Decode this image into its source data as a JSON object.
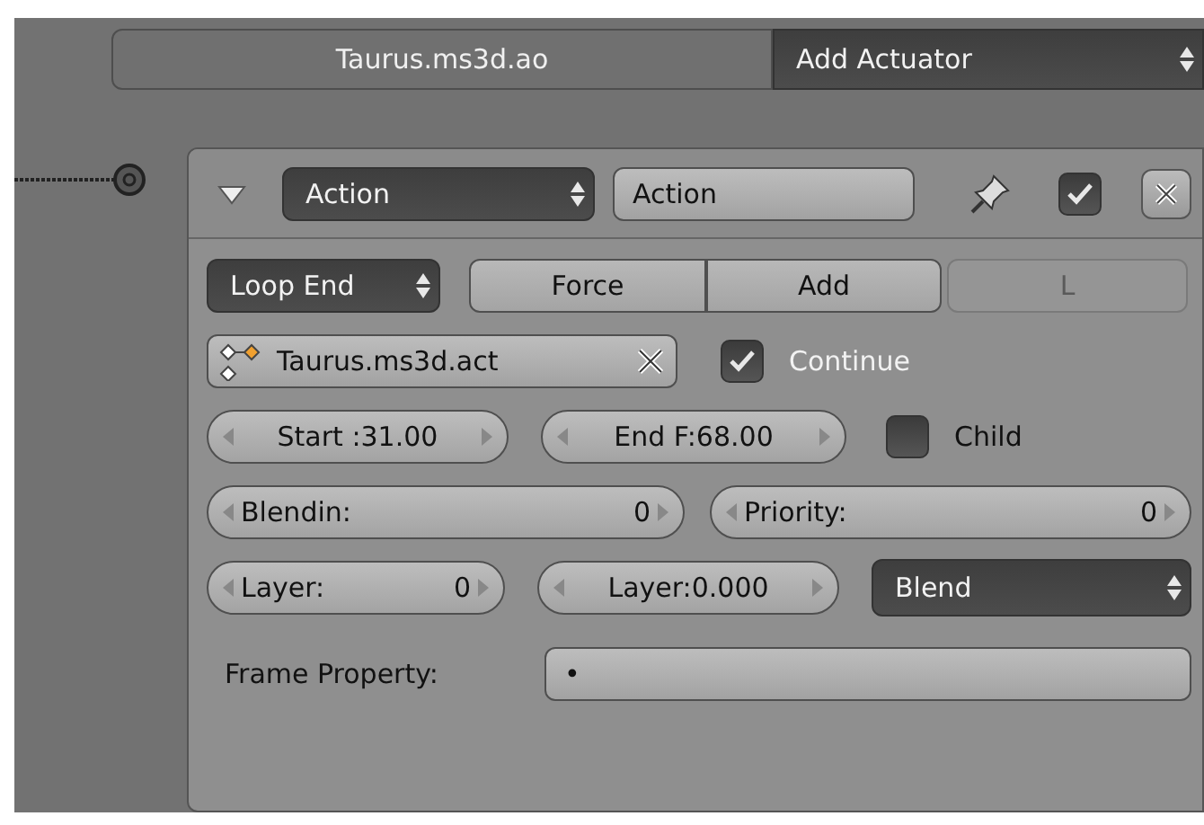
{
  "top_bar": {
    "object_name": "Taurus.ms3d.ao",
    "add_menu": "Add Actuator"
  },
  "actuator": {
    "expanded": true,
    "type": "Action",
    "name": "Action",
    "active": true,
    "play_mode": "Loop End",
    "toggles": [
      {
        "label": "Force",
        "disabled": false
      },
      {
        "label": "Add",
        "disabled": false
      },
      {
        "label": "L",
        "disabled": true
      }
    ],
    "action": "Taurus.ms3d.act",
    "continue": {
      "label": "Continue",
      "checked": true
    },
    "start": {
      "label": "Start :",
      "value": "31.00",
      "kind": "compact"
    },
    "end": {
      "label": "End F:",
      "value": "68.00",
      "kind": "compact"
    },
    "child": {
      "label": "Child",
      "checked": false
    },
    "blendin": {
      "label": "Blendin:",
      "value": "0",
      "kind": "spread"
    },
    "priority": {
      "label": "Priority:",
      "value": "0",
      "kind": "spread"
    },
    "layer": {
      "label": "Layer:",
      "value": "0",
      "kind": "spread"
    },
    "layer_weight": {
      "label": "Layer:",
      "value": "0.000",
      "kind": "compact"
    },
    "blend_mode": "Blend",
    "frame_property": {
      "label": "Frame Property:",
      "value": "•"
    }
  }
}
